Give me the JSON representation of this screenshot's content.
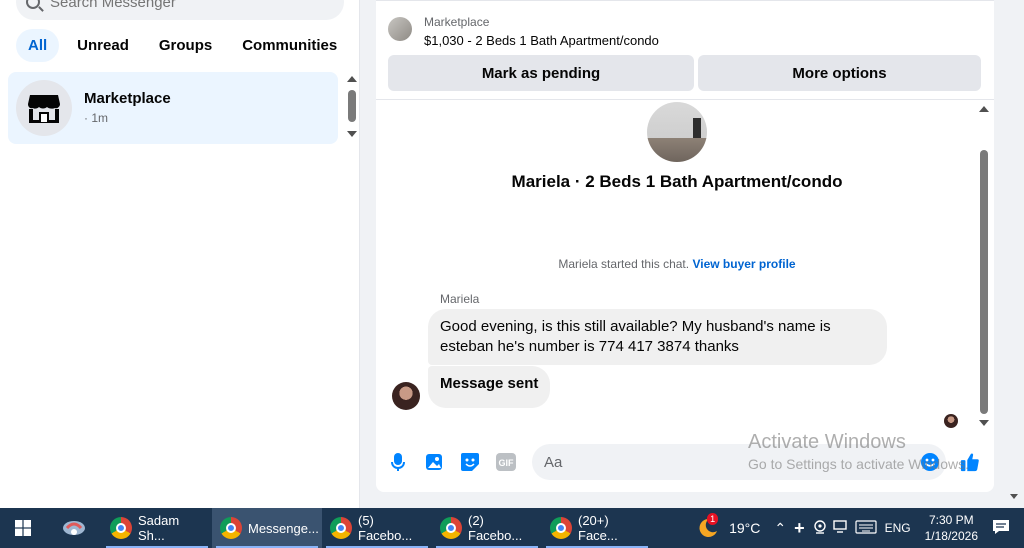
{
  "sidebar": {
    "search_placeholder": "Search Messenger",
    "filters": [
      "All",
      "Unread",
      "Groups",
      "Communities"
    ],
    "conversation": {
      "name": "Marketplace",
      "time": "· 1m"
    }
  },
  "chat": {
    "marketplace_label": "Marketplace",
    "listing": "$1,030 - 2 Beds 1 Bath Apartment/condo",
    "mark_pending": "Mark as pending",
    "more_options": "More options",
    "title": "Mariela · 2 Beds 1 Bath Apartment/condo",
    "started_text": "Mariela started this chat.",
    "buyer_profile_link": "View buyer profile",
    "sender_name": "Mariela",
    "message1": "Good evening, is this still available? My husband's name is esteban he's number is 774 417 3874 thanks",
    "message2": "Message sent",
    "input_placeholder": "Aa"
  },
  "watermark": {
    "line1": "Activate Windows",
    "line2": "Go to Settings to activate Windows."
  },
  "taskbar": {
    "apps": [
      {
        "label": "Sadam Sh...",
        "icon": "chrome-icon"
      },
      {
        "label": "Messenge...",
        "icon": "chrome-icon"
      },
      {
        "label": "(5) Facebo...",
        "icon": "chrome-icon"
      },
      {
        "label": "(2) Facebo...",
        "icon": "chrome-icon"
      },
      {
        "label": "(20+) Face...",
        "icon": "chrome-icon"
      }
    ],
    "weather_badge": "1",
    "temperature": "19°C",
    "language": "ENG",
    "time": "7:30 PM",
    "date": "1/18/2026"
  },
  "colors": {
    "accent": "#0084ff",
    "selected_bg": "#ebf5ff",
    "taskbar_bg": "#1c3550"
  }
}
